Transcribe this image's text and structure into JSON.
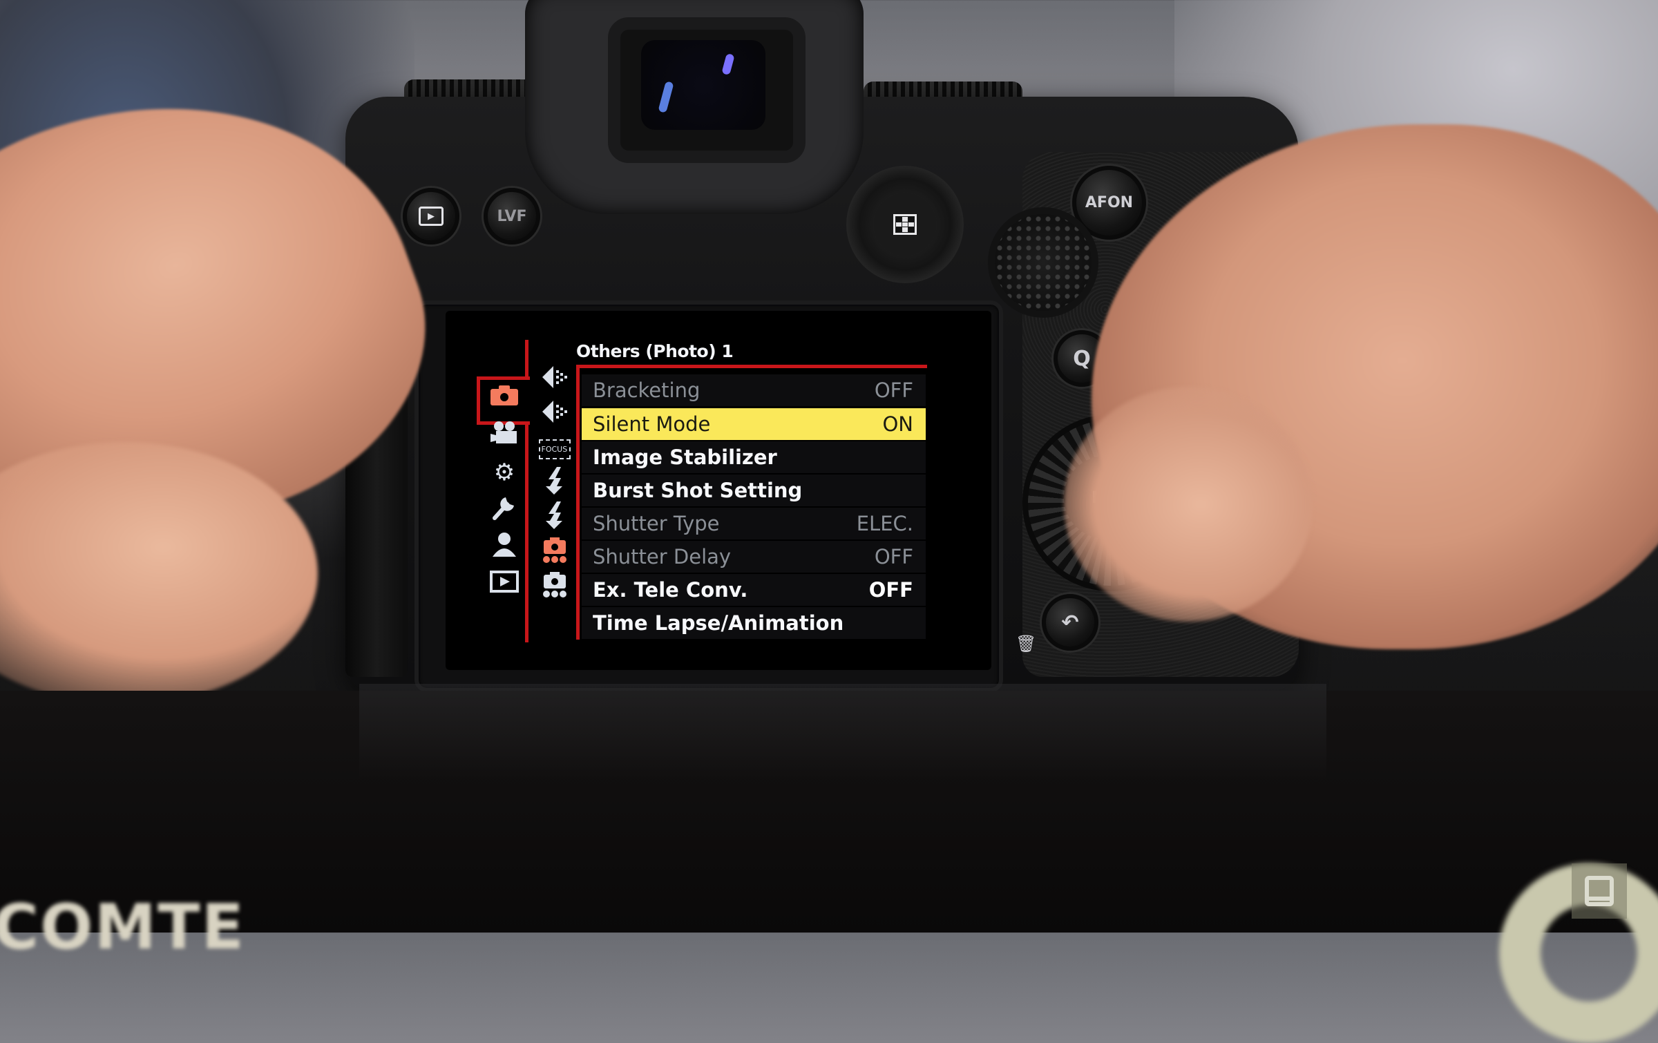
{
  "scene": {
    "description": "Mirrorless camera rear view with on-screen menu, held by two hands"
  },
  "camera_buttons": {
    "playback_icon": "playback-icon",
    "lvf_label": "LVF",
    "joystick_icon": "grid-icon",
    "afon_label": "AFON",
    "q_label": "Q",
    "menu_label": "ME",
    "back_icon": "⤶",
    "trash_icon": "🗑"
  },
  "menu": {
    "title": "Others (Photo) 1",
    "accent_color": "#c8161a",
    "highlight_color": "#fae85a",
    "main_tabs": [
      {
        "name": "photo",
        "icon": "camera-icon",
        "glyph": "📷",
        "active": true
      },
      {
        "name": "video",
        "icon": "video-camera-icon",
        "glyph": "🎥",
        "active": false
      },
      {
        "name": "custom",
        "icon": "gear-icon",
        "glyph": "⚙",
        "active": false
      },
      {
        "name": "setup",
        "icon": "wrench-icon",
        "glyph": "🔧",
        "active": false
      },
      {
        "name": "my-menu",
        "icon": "person-icon",
        "glyph": "👤",
        "active": false
      },
      {
        "name": "playback",
        "icon": "playback-icon",
        "glyph": "▶",
        "active": false
      }
    ],
    "sub_tabs": [
      {
        "name": "image-quality-1",
        "icon": "image-quality-icon",
        "glyph": "◀"
      },
      {
        "name": "image-quality-2",
        "icon": "image-quality-icon",
        "glyph": "◀"
      },
      {
        "name": "focus",
        "icon": "focus-icon",
        "glyph": "FOCUS"
      },
      {
        "name": "flash-1",
        "icon": "flash-icon",
        "glyph": "ϟ"
      },
      {
        "name": "flash-2",
        "icon": "flash-icon",
        "glyph": "ϟ"
      },
      {
        "name": "others-photo-1",
        "icon": "camera-others-icon",
        "glyph": "●",
        "active": true
      },
      {
        "name": "others-photo-2",
        "icon": "camera-others-icon",
        "glyph": "●",
        "active": false
      }
    ],
    "items": [
      {
        "label": "Bracketing",
        "value": "OFF",
        "state": "dim"
      },
      {
        "label": "Silent Mode",
        "value": "ON",
        "state": "selected"
      },
      {
        "label": "Image Stabilizer",
        "value": "",
        "state": "bright"
      },
      {
        "label": "Burst Shot Setting",
        "value": "",
        "state": "bright"
      },
      {
        "label": "Shutter Type",
        "value": "ELEC.",
        "state": "dim"
      },
      {
        "label": "Shutter Delay",
        "value": "OFF",
        "state": "dim"
      },
      {
        "label": "Ex. Tele Conv.",
        "value": "OFF",
        "state": "bright"
      },
      {
        "label": "Time Lapse/Animation",
        "value": "",
        "state": "bright"
      }
    ]
  },
  "foreground": {
    "box_text": "COMTE"
  },
  "watermark": {
    "logo": "engadget-logo"
  }
}
